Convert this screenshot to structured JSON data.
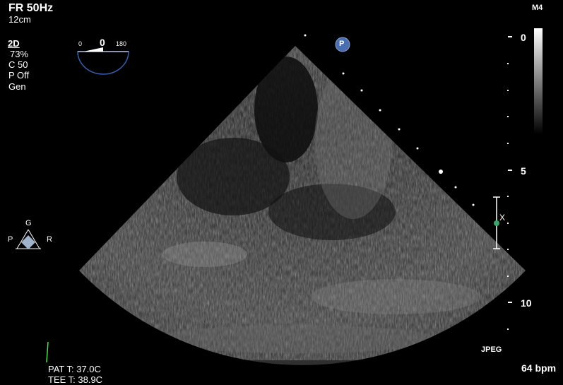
{
  "header": {
    "frame_rate": "FR 50Hz",
    "depth": "12cm",
    "preset": "M4"
  },
  "mode_settings": {
    "mode": "2D",
    "gain": "73%",
    "compression": "C 50",
    "power": "P Off",
    "profile": "Gen"
  },
  "angle_indicator": {
    "min_label": "0",
    "value": "0",
    "max_label": "180"
  },
  "orientation": {
    "top": "G",
    "left": "P",
    "right": "R"
  },
  "probe_marker": "P",
  "depth_scale": {
    "marks": [
      "0",
      "5",
      "10"
    ]
  },
  "focus_marker": "X",
  "format_label": "JPEG",
  "heart_rate": "64 bpm",
  "temperatures": {
    "patient": "PAT T: 37.0C",
    "tee": "TEE T: 38.9C"
  },
  "colors": {
    "background": "#000000",
    "text": "#ffffff",
    "probe_badge": "#4a6fb0",
    "focus_dot": "#3aa66a",
    "ecg_trace": "#55dd55"
  }
}
